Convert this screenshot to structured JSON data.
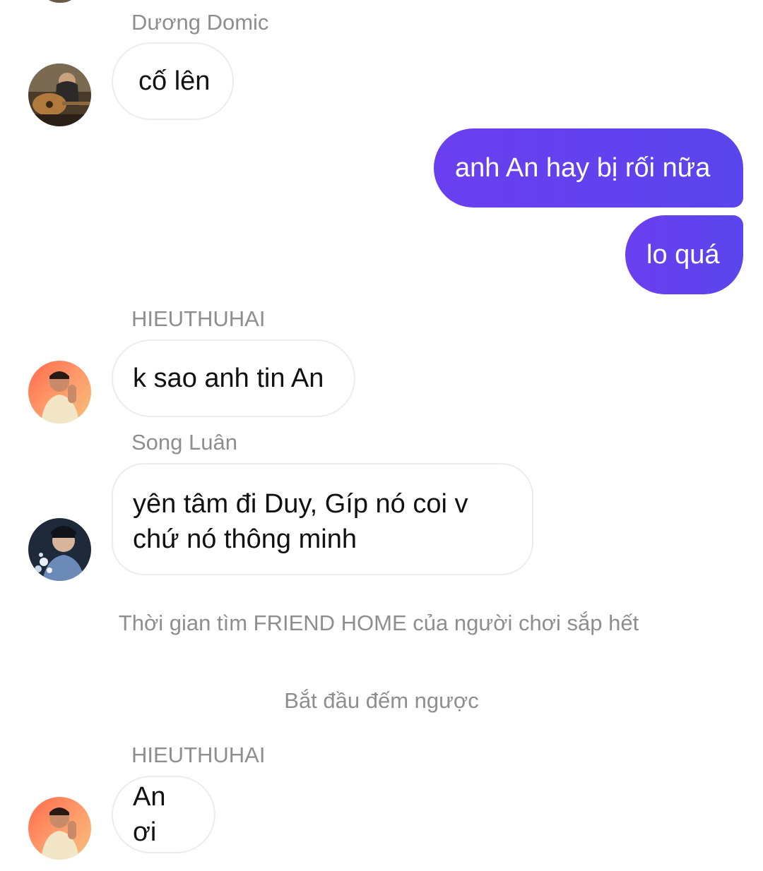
{
  "messages": {
    "m1": {
      "sender": "Dương Domic",
      "text": "cố lên"
    },
    "m2": {
      "text": "anh An hay bị rối nữa"
    },
    "m3": {
      "text": "lo quá"
    },
    "m4": {
      "sender": "HIEUTHUHAI",
      "text": "k sao anh tin An"
    },
    "m5": {
      "sender": "Song Luân",
      "line1": "yên tâm đi Duy, Gíp nó coi v",
      "line2": "chứ nó thông minh"
    },
    "m6": {
      "sender": "HIEUTHUHAI",
      "text": "An ơi"
    }
  },
  "system": {
    "s1": "Thời gian tìm FRIEND HOME của người chơi sắp hết",
    "s2": "Bắt đầu đếm ngược"
  },
  "colors": {
    "outgoing_bubble": "#5f42ee",
    "incoming_border": "#ececec",
    "meta_text": "#8e8e8e"
  }
}
